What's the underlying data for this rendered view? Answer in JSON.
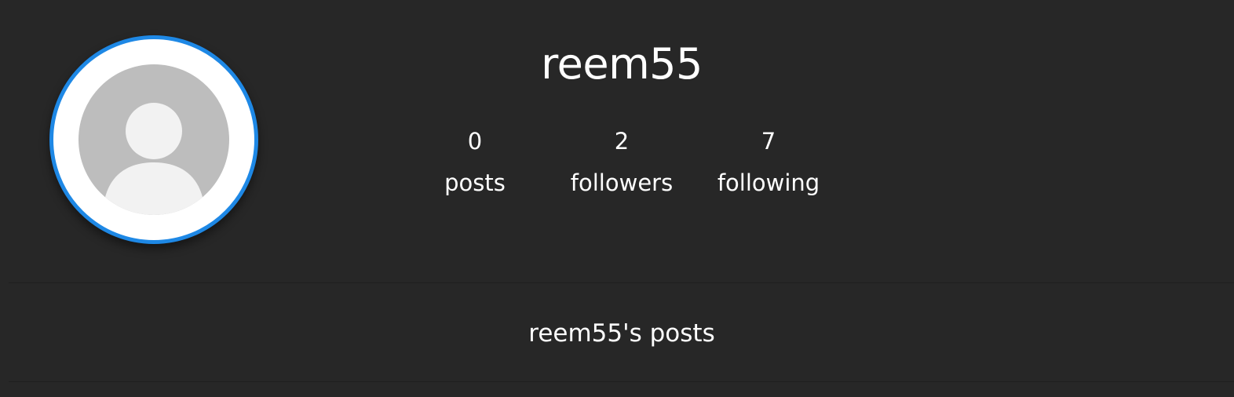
{
  "profile": {
    "username": "reem55",
    "avatar_icon": "default-user-icon",
    "accent_color": "#1e88e5",
    "stats": [
      {
        "value": "0",
        "label": "posts"
      },
      {
        "value": "2",
        "label": "followers"
      },
      {
        "value": "7",
        "label": "following"
      }
    ]
  },
  "posts_section": {
    "heading": "reem55's posts"
  }
}
